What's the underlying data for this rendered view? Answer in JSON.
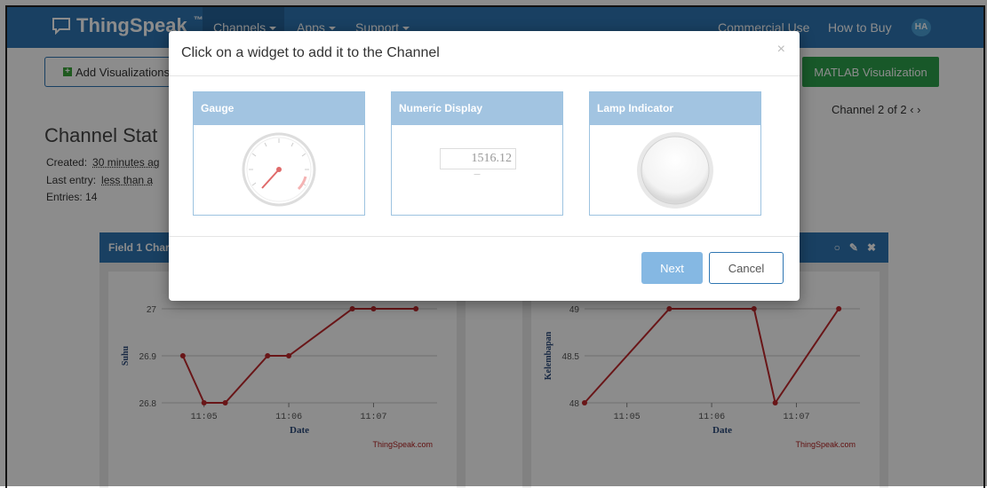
{
  "navbar": {
    "brand": "ThingSpeak",
    "trademark": "™",
    "items": [
      {
        "label": "Channels"
      },
      {
        "label": "Apps"
      },
      {
        "label": "Support"
      }
    ],
    "right": [
      {
        "label": "Commercial Use"
      },
      {
        "label": "How to Buy"
      }
    ],
    "avatar": "HA"
  },
  "page": {
    "add_visualizations": "Add Visualizations",
    "matlab_visualization": "MATLAB Visualization",
    "channel_nav": "Channel 2 of 2",
    "title": "Channel Stat",
    "created_label": "Created:",
    "created_value": "30 minutes ag",
    "last_entry_label": "Last entry:",
    "last_entry_value": "less than a",
    "entries": "Entries: 14"
  },
  "charts": [
    {
      "title": "Field 1 Char",
      "ylabel": "Suhu",
      "xlabel": "Date",
      "credit": "ThingSpeak.com",
      "y_ticks": [
        "27",
        "26.9",
        "26.8"
      ],
      "x_ticks": [
        "11:05",
        "11:06",
        "11:07"
      ]
    },
    {
      "title": "",
      "ylabel": "Kelembapan",
      "xlabel": "Date",
      "credit": "ThingSpeak.com",
      "y_ticks": [
        "49",
        "48.5",
        "48"
      ],
      "x_ticks": [
        "11:05",
        "11:06",
        "11:07"
      ]
    }
  ],
  "chart_data": [
    {
      "type": "line",
      "xlabel": "Date",
      "ylabel": "Suhu",
      "ylim": [
        26.8,
        27
      ],
      "x": [
        "11:04:45",
        "11:05:00",
        "11:05:15",
        "11:05:45",
        "11:06:00",
        "11:06:45",
        "11:07:00",
        "11:07:30"
      ],
      "values": [
        26.9,
        26.8,
        26.8,
        26.9,
        26.9,
        27.0,
        27.0,
        27.0
      ],
      "color": "#c0282d"
    },
    {
      "type": "line",
      "xlabel": "Date",
      "ylabel": "Kelembapan",
      "ylim": [
        48,
        49
      ],
      "x": [
        "11:04:30",
        "11:05:30",
        "11:06:30",
        "11:06:45",
        "11:07:30"
      ],
      "values": [
        48,
        49,
        49,
        48,
        49
      ],
      "color": "#c0282d"
    }
  ],
  "modal": {
    "title": "Click on a widget to add it to the Channel",
    "close": "×",
    "widgets": [
      {
        "label": "Gauge"
      },
      {
        "label": "Numeric Display",
        "value": "1516.12"
      },
      {
        "label": "Lamp Indicator"
      }
    ],
    "next": "Next",
    "cancel": "Cancel"
  },
  "colors": {
    "navbar": "#2f76b2",
    "accent_green": "#2da14b",
    "series": "#c0282d",
    "widget_header": "#a2c4e1"
  }
}
